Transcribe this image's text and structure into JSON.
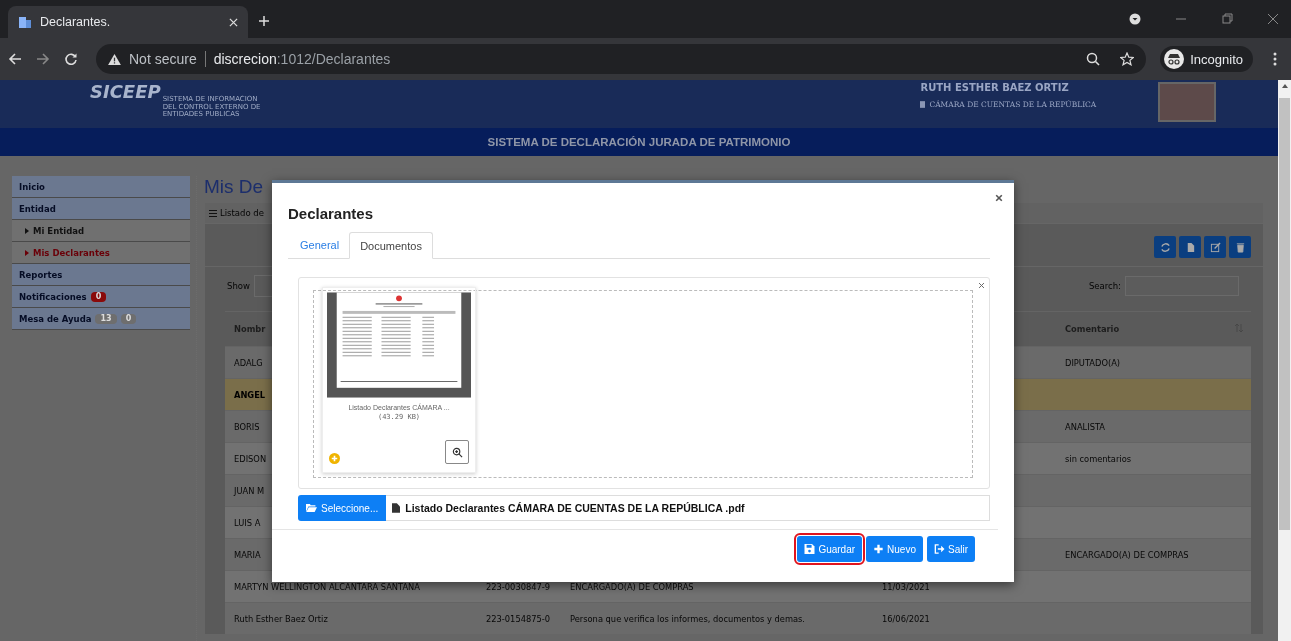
{
  "browser": {
    "tab_title": "Declarantes.",
    "security": "Not secure",
    "url_host": "discrecion",
    "url_path": ":1012/Declarantes",
    "profile": "Incognito"
  },
  "header": {
    "logo": "SICEEP",
    "logo_lines": [
      "SISTEMA DE INFORMACION",
      "DEL CONTROL EXTERNO DE",
      "ENTIDADES PUBLICAS"
    ],
    "user_name": "RUTH ESTHER BAEZ ORTIZ",
    "institution": "CÁMARA DE CUENTAS DE LA REPÚBLICA",
    "banner": "SISTEMA DE DECLARACIÓN JURADA DE PATRIMONIO"
  },
  "sidebar": {
    "items": [
      {
        "label": "Inicio",
        "kind": "section",
        "selected": false
      },
      {
        "label": "Entidad",
        "kind": "section",
        "selected": false
      },
      {
        "label": "Mi Entidad",
        "kind": "sub",
        "selected": false
      },
      {
        "label": "Mis Declarantes",
        "kind": "sub",
        "selected": true
      },
      {
        "label": "Reportes",
        "kind": "section",
        "selected": false
      },
      {
        "label": "Notificaciones",
        "kind": "section",
        "selected": false,
        "badges": [
          {
            "text": "0",
            "color": "#8a0a0a"
          }
        ]
      },
      {
        "label": "Mesa de Ayuda",
        "kind": "section",
        "selected": false,
        "badges": [
          {
            "text": "13",
            "color": "#6e6e6e"
          },
          {
            "text": "0",
            "color": "#6e6e6e"
          }
        ]
      }
    ]
  },
  "main": {
    "title": "Mis De",
    "panel_title": "Listado de",
    "show_label": "Show",
    "search_label": "Search:",
    "columns": [
      "Nombr",
      "",
      "",
      "",
      "Comentario"
    ],
    "rows": [
      {
        "cells": [
          "ADALG",
          "",
          "",
          "",
          "DIPUTADO(A)"
        ],
        "selected": false
      },
      {
        "cells": [
          "ANGEL",
          "",
          "",
          "",
          ""
        ],
        "selected": true
      },
      {
        "cells": [
          "BORIS",
          "",
          "",
          "",
          "ANALISTA"
        ],
        "selected": false
      },
      {
        "cells": [
          "EDISON",
          "",
          "",
          "",
          "sin comentarios"
        ],
        "selected": false
      },
      {
        "cells": [
          "JUAN M",
          "",
          "",
          "",
          ""
        ],
        "selected": false
      },
      {
        "cells": [
          "LUIS A",
          "",
          "",
          "",
          ""
        ],
        "selected": false
      },
      {
        "cells": [
          "MARIA",
          "",
          "",
          "",
          "ENCARGADO(A) DE COMPRAS"
        ],
        "selected": false
      },
      {
        "cells": [
          "MARTYN WELLINGTON ALCANTARA SANTANA",
          "223-0030847-9",
          "ENCARGADO(A) DE COMPRAS",
          "11/03/2021",
          ""
        ],
        "selected": false
      },
      {
        "cells": [
          "Ruth Esther Baez Ortiz",
          "223-0154875-0",
          "Persona que verifica los informes, documentos y demas.",
          "16/06/2021",
          ""
        ],
        "selected": false
      }
    ]
  },
  "modal": {
    "title": "Declarantes",
    "tabs": [
      {
        "label": "General",
        "selected": false
      },
      {
        "label": "Documentos",
        "selected": true
      }
    ],
    "file_caption": "Listado Declarantes CÁMARA ...",
    "file_size": "(43.29 KB)",
    "select_button": "Seleccione...",
    "file_name": "Listado Declarantes CÁMARA DE CUENTAS DE LA REPÚBLICA .pdf",
    "buttons": [
      {
        "label": "Guardar",
        "kind": "save",
        "focused": true
      },
      {
        "label": "Nuevo",
        "kind": "new",
        "focused": false
      },
      {
        "label": "Salir",
        "kind": "exit",
        "focused": false
      }
    ]
  }
}
